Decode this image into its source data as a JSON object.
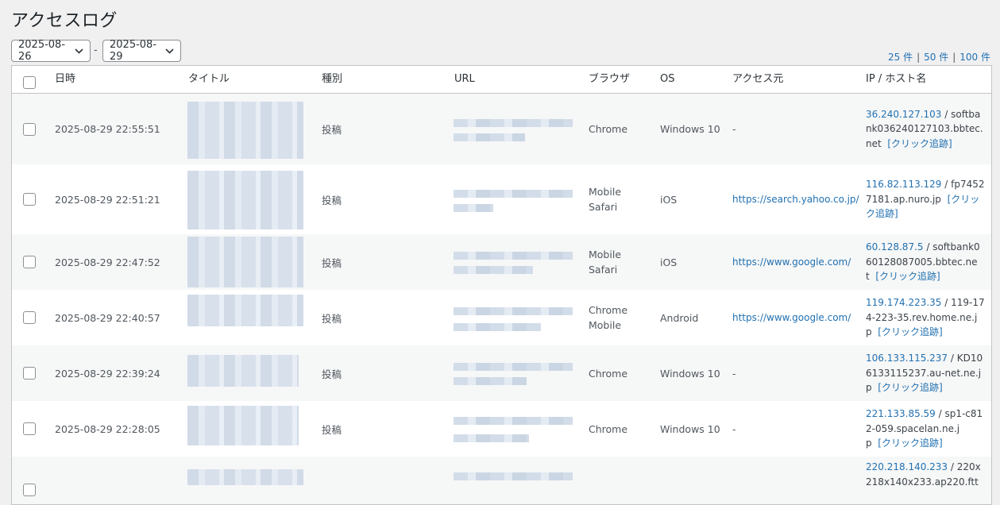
{
  "page": {
    "title": "アクセスログ"
  },
  "filters": {
    "date_from": "2025-08-26",
    "separator": "-",
    "date_to": "2025-08-29"
  },
  "per_page": {
    "opt1": "25 件",
    "opt2": "50 件",
    "opt3": "100 件",
    "sep": "|"
  },
  "columns": {
    "date": "日時",
    "title": "タイトル",
    "type": "種別",
    "url": "URL",
    "browser": "ブラウザ",
    "os": "OS",
    "referrer": "アクセス元",
    "ip": "IP / ホスト名"
  },
  "rows": [
    {
      "date": "2025-08-29 22:55:51",
      "type": "投稿",
      "browser": "Chrome",
      "os": "Windows 10",
      "referrer": "-",
      "ip": "36.240.127.103",
      "host": " / softbank036240127103.bbtec.net",
      "track": "[クリック追跡]"
    },
    {
      "date": "2025-08-29 22:51:21",
      "type": "投稿",
      "browser": "Mobile Safari",
      "os": "iOS",
      "referrer": "https://search.yahoo.co.jp/",
      "ip": "116.82.113.129",
      "host": " / fp74527181.ap.nuro.jp",
      "track": "[クリック追跡]"
    },
    {
      "date": "2025-08-29 22:47:52",
      "type": "投稿",
      "browser": "Mobile Safari",
      "os": "iOS",
      "referrer": "https://www.google.com/",
      "ip": "60.128.87.5",
      "host": " / softbank060128087005.bbtec.net",
      "track": "[クリック追跡]"
    },
    {
      "date": "2025-08-29 22:40:57",
      "type": "投稿",
      "browser": "Chrome Mobile",
      "os": "Android",
      "referrer": "https://www.google.com/",
      "ip": "119.174.223.35",
      "host": " / 119-174-223-35.rev.home.ne.jp",
      "track": "[クリック追跡]"
    },
    {
      "date": "2025-08-29 22:39:24",
      "type": "投稿",
      "browser": "Chrome",
      "os": "Windows 10",
      "referrer": "-",
      "ip": "106.133.115.237",
      "host": " / KD106133115237.au-net.ne.jp",
      "track": "[クリック追跡]"
    },
    {
      "date": "2025-08-29 22:28:05",
      "type": "投稿",
      "browser": "Chrome",
      "os": "Windows 10",
      "referrer": "-",
      "ip": "221.133.85.59",
      "host": " / sp1-c812-059.spacelan.ne.jp",
      "track": "[クリック追跡]"
    },
    {
      "date": "",
      "type": "",
      "browser": "",
      "os": "",
      "referrer": "",
      "ip": "220.218.140.233",
      "host": " / 220x218x140x233.ap220.ftt",
      "track": ""
    }
  ]
}
